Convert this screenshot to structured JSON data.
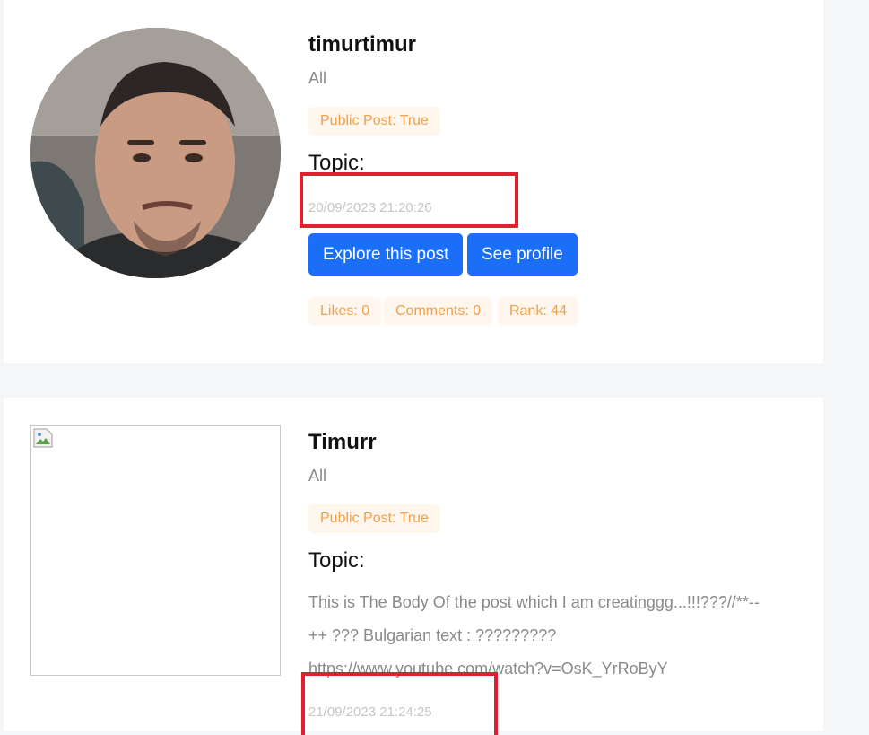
{
  "posts": [
    {
      "author": "timurtimur",
      "category": "All",
      "public_badge": "Public Post: True",
      "topic_label": "Topic:",
      "timestamp": "20/09/2023 21:20:26",
      "buttons": {
        "explore": "Explore this post",
        "profile": "See profile"
      },
      "stats": {
        "likes": "Likes: 0",
        "comments": "Comments: 0",
        "rank": "Rank: 44"
      }
    },
    {
      "author": "Timurr",
      "category": "All",
      "public_badge": "Public Post: True",
      "topic_label": "Topic:",
      "body_lines": [
        "This is The Body Of the post which I am creatinggg...!!!???//**--",
        "++ ??? Bulgarian text : ?????????",
        "https://www.youtube.com/watch?v=OsK_YrRoByY"
      ],
      "timestamp": "21/09/2023 21:24:25"
    }
  ],
  "colors": {
    "accent": "#1a6ef7",
    "badge_text": "#f0a04b",
    "badge_bg": "#fff7ee",
    "highlight": "#e0202e"
  }
}
